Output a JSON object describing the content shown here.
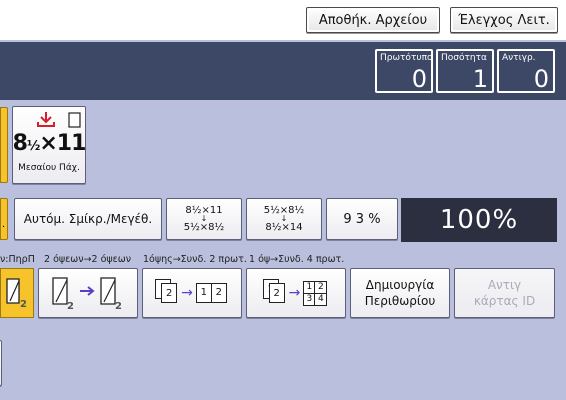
{
  "header": {
    "store_file_label": "Αποθήκ. Αρχείου",
    "check_modes_label": "Έλεγχος Λειτ."
  },
  "counters": [
    {
      "label": "Πρωτότυπο",
      "value": "0"
    },
    {
      "label": "Ποσότητα",
      "value": "1"
    },
    {
      "label": "Αντιγρ.",
      "value": "0"
    }
  ],
  "paper": {
    "size_whole": "8",
    "size_fraction": "½",
    "size_suffix": "×11",
    "tray_label": "Μεσαίου Πάχ."
  },
  "reduce_enlarge": {
    "auto_label": "Αυτόμ. Σμίκρ./Μεγέθ.",
    "preset1_top": "8½×11",
    "preset1_bottom": "5½×8½",
    "preset2_top": "5½×8½",
    "preset2_bottom": "8½×14",
    "percent_93": "9 3 %",
    "percent_100": "100%"
  },
  "duplex": {
    "caption_first": "ν:ΠηρΠ",
    "caption_2sided": "2 όψεων→2 όψεων",
    "caption_combine2": "1όψης→Συνδ. 2 πρωτ.",
    "caption_combine4": "1 όψ→Συνδ. 4 πρωτ.",
    "page_2": "2",
    "page_1": "1",
    "page_3": "3",
    "page_4": "4"
  },
  "functions": {
    "margin_label_line1": "Δημιουργία",
    "margin_label_line2": "Περιθωρίου",
    "id_copy_line1": "Αντιγ",
    "id_copy_line2": "κάρτας ID"
  },
  "colors": {
    "background": "#b9bfdc",
    "dark_bar": "#3d4766",
    "selected_yellow": "#f6c32b",
    "display_black": "#2b2f40",
    "accent_red": "#d3202a",
    "arrow_purple": "#5a3ec8"
  }
}
